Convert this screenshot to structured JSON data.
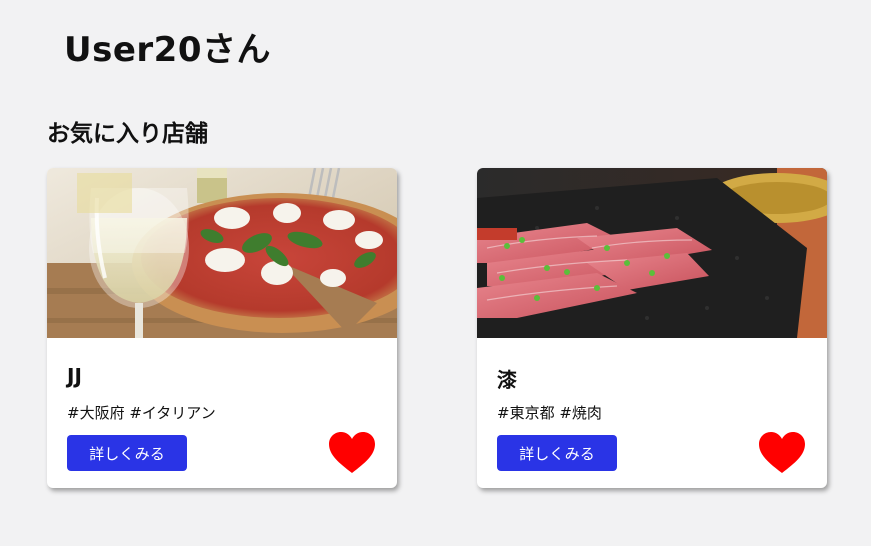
{
  "user": {
    "greeting": "User20さん"
  },
  "favorites": {
    "section_title": "お気に入り店舗",
    "shops": [
      {
        "name": "JJ",
        "tags": "#大阪府 #イタリアン",
        "detail_label": "詳しくみる",
        "image": "pizza-and-wine-photo",
        "favorited": true
      },
      {
        "name": "漆",
        "tags": "#東京都 #焼肉",
        "detail_label": "詳しくみる",
        "image": "yakiniku-beef-photo",
        "favorited": true
      }
    ]
  },
  "colors": {
    "background": "#f2f2f3",
    "button": "#2a34e6",
    "heart": "#ff0000"
  }
}
